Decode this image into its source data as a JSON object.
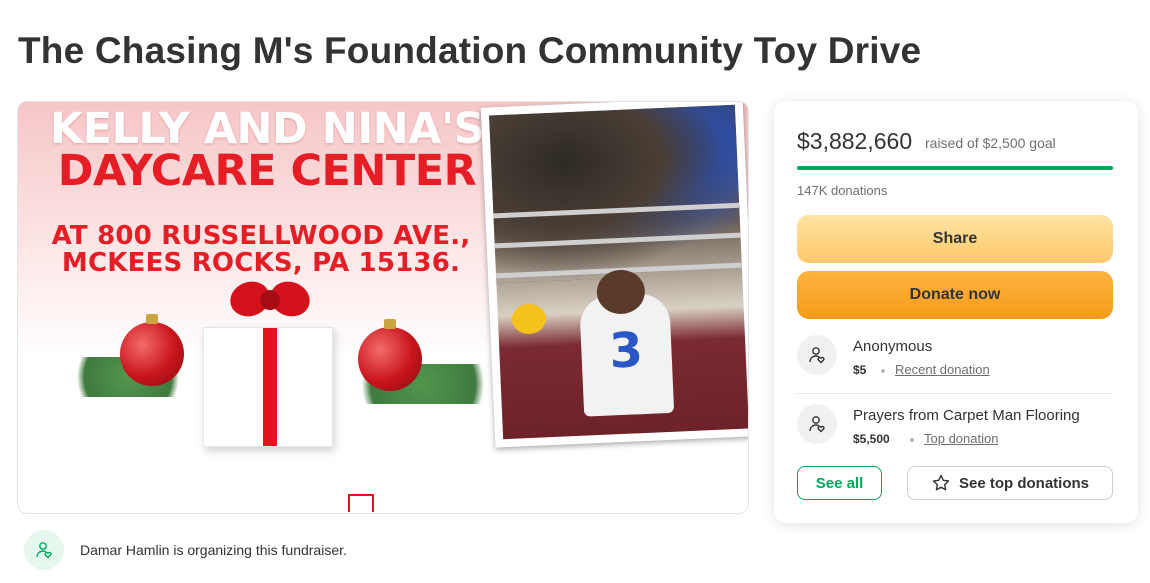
{
  "page": {
    "title": "The Chasing M's Foundation Community Toy Drive"
  },
  "hero": {
    "line1": "KELLY AND NINA'S",
    "line2": "DAYCARE CENTER",
    "address_line1": "AT 800 RUSSELLWOOD AVE.,",
    "address_line2": "MCKEES ROCKS, PA 15136.",
    "jersey_number": "3"
  },
  "donation_card": {
    "amount_raised": "$3,882,660",
    "goal_text": "raised of $2,500 goal",
    "progress_fraction": 1.0,
    "donation_count": "147K donations",
    "share_label": "Share",
    "donate_label": "Donate now",
    "donations": [
      {
        "name": "Anonymous",
        "amount": "$5",
        "tag": "Recent donation"
      },
      {
        "name": "Prayers from Carpet Man Flooring",
        "amount": "$5,500",
        "tag": "Top donation"
      }
    ],
    "see_all_label": "See all",
    "see_top_label": "See top donations"
  },
  "organizer": {
    "text": "Damar Hamlin is organizing this fundraiser."
  },
  "colors": {
    "brand_green": "#02a95c",
    "donate_orange": "#f79a1a",
    "share_yellow": "#fdc96a",
    "hero_red": "#e51d24"
  },
  "icons": {
    "donor_avatar": "person-heart-icon",
    "star": "star-icon",
    "organizer_avatar": "person-heart-icon"
  }
}
